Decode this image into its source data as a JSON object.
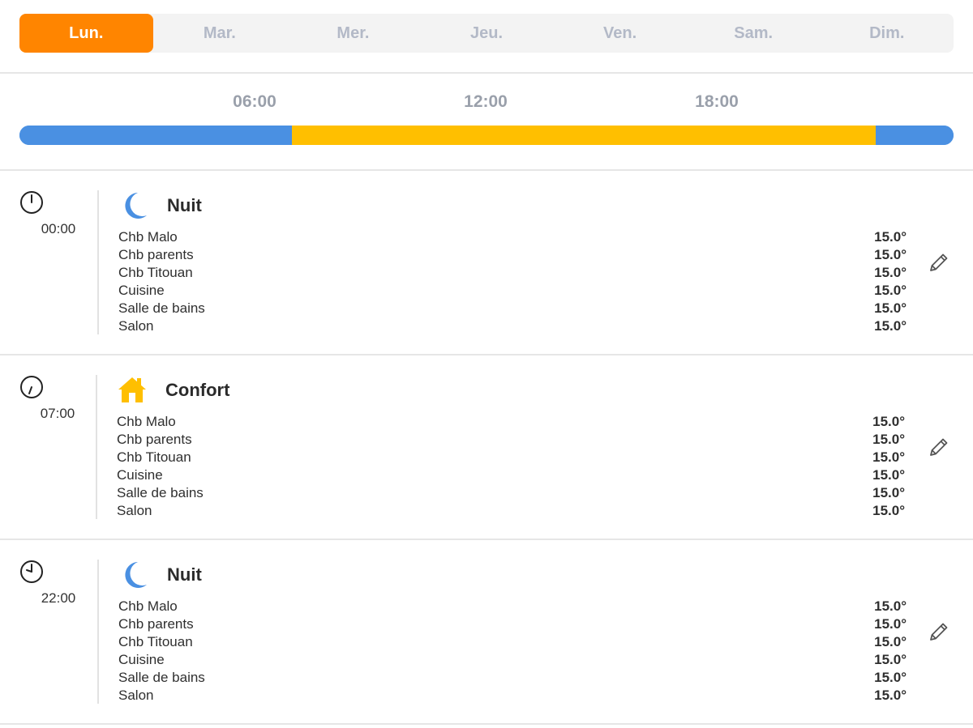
{
  "days": {
    "items": [
      {
        "label": "Lun.",
        "active": true
      },
      {
        "label": "Mar.",
        "active": false
      },
      {
        "label": "Mer.",
        "active": false
      },
      {
        "label": "Jeu.",
        "active": false
      },
      {
        "label": "Ven.",
        "active": false
      },
      {
        "label": "Sam.",
        "active": false
      },
      {
        "label": "Dim.",
        "active": false
      }
    ]
  },
  "timeline": {
    "ticks": [
      "06:00",
      "12:00",
      "18:00"
    ],
    "segments": [
      {
        "from_hour": 0,
        "to_hour": 7,
        "mode": "Nuit"
      },
      {
        "from_hour": 7,
        "to_hour": 22,
        "mode": "Confort"
      },
      {
        "from_hour": 22,
        "to_hour": 24,
        "mode": "Nuit"
      }
    ]
  },
  "colors": {
    "accent": "#ff8500",
    "nuit": "#4a90e2",
    "confort": "#ffbf00",
    "tab_inactive_text": "#b3b9c7",
    "tab_bg": "#f3f3f3"
  },
  "slots": [
    {
      "time": "00:00",
      "mode": "Nuit",
      "icon": "moon-icon",
      "rooms": [
        {
          "name": "Chb Malo",
          "temp": "15.0°"
        },
        {
          "name": "Chb parents",
          "temp": "15.0°"
        },
        {
          "name": "Chb Titouan",
          "temp": "15.0°"
        },
        {
          "name": "Cuisine",
          "temp": "15.0°"
        },
        {
          "name": "Salle de bains",
          "temp": "15.0°"
        },
        {
          "name": "Salon",
          "temp": "15.0°"
        }
      ]
    },
    {
      "time": "07:00",
      "mode": "Confort",
      "icon": "house-icon",
      "rooms": [
        {
          "name": "Chb Malo",
          "temp": "15.0°"
        },
        {
          "name": "Chb parents",
          "temp": "15.0°"
        },
        {
          "name": "Chb Titouan",
          "temp": "15.0°"
        },
        {
          "name": "Cuisine",
          "temp": "15.0°"
        },
        {
          "name": "Salle de bains",
          "temp": "15.0°"
        },
        {
          "name": "Salon",
          "temp": "15.0°"
        }
      ]
    },
    {
      "time": "22:00",
      "mode": "Nuit",
      "icon": "moon-icon",
      "rooms": [
        {
          "name": "Chb Malo",
          "temp": "15.0°"
        },
        {
          "name": "Chb parents",
          "temp": "15.0°"
        },
        {
          "name": "Chb Titouan",
          "temp": "15.0°"
        },
        {
          "name": "Cuisine",
          "temp": "15.0°"
        },
        {
          "name": "Salle de bains",
          "temp": "15.0°"
        },
        {
          "name": "Salon",
          "temp": "15.0°"
        }
      ]
    }
  ]
}
